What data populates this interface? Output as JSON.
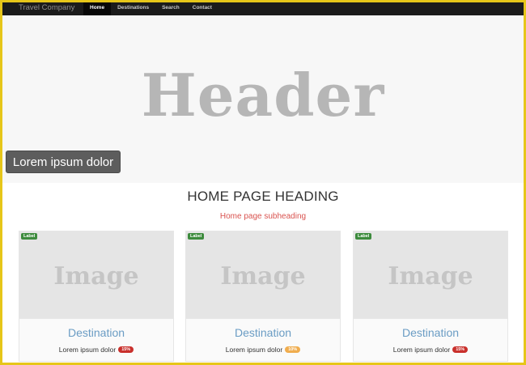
{
  "navbar": {
    "brand": "Travel Company",
    "items": [
      {
        "label": "Home",
        "active": true
      },
      {
        "label": "Destinations",
        "active": false
      },
      {
        "label": "Search",
        "active": false
      },
      {
        "label": "Contact",
        "active": false
      }
    ]
  },
  "hero": {
    "title": "Header",
    "caption": "Lorem ipsum dolor"
  },
  "main": {
    "heading": "HOME PAGE HEADING",
    "subheading": "Home page subheading"
  },
  "cards": [
    {
      "label": "Label",
      "image_text": "Image",
      "title": "Destination",
      "desc": "Lorem ipsum dolor",
      "badge": "15%",
      "badge_color": "#c9302c"
    },
    {
      "label": "Label",
      "image_text": "Image",
      "title": "Destination",
      "desc": "Lorem ipsum dolor",
      "badge": "10%",
      "badge_color": "#f0ad4e"
    },
    {
      "label": "Label",
      "image_text": "Image",
      "title": "Destination",
      "desc": "Lorem ipsum dolor",
      "badge": "15%",
      "badge_color": "#c9302c"
    }
  ],
  "colors": {
    "frame": "#e6c619",
    "navbar_bg": "#1b1b1b",
    "subheading": "#d9534f",
    "card_title": "#6a9cc4",
    "label_green": "#3d8b3d"
  }
}
